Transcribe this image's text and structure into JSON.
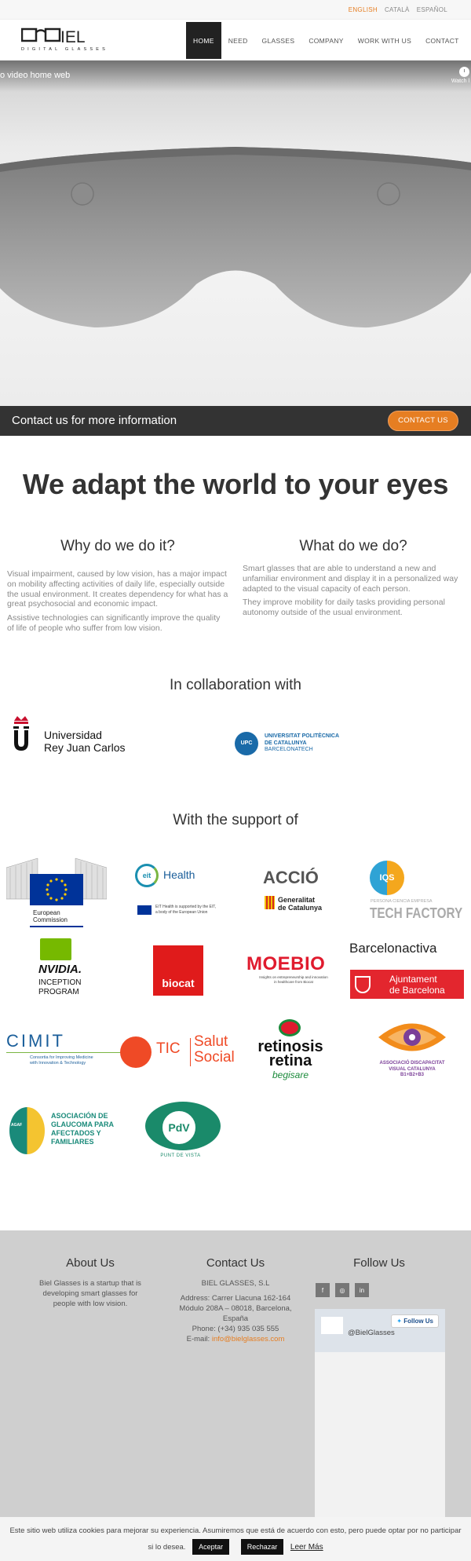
{
  "languages": {
    "english": "ENGLISH",
    "catala": "CATALÀ",
    "espanol": "ESPAÑOL"
  },
  "logo": {
    "brand_text": "IEL",
    "tagline": "DIGITAL GLASSES"
  },
  "nav": [
    "HOME",
    "NEED",
    "GLASSES",
    "COMPANY",
    "WORK WITH US",
    "CONTACT"
  ],
  "hero": {
    "video_title": "o video home web",
    "watch_later": "Watch l"
  },
  "cta": {
    "text": "Contact us for more information",
    "button": "CONTACT US"
  },
  "headline": "We adapt the world to your eyes",
  "why": {
    "title": "Why do we do it?",
    "p1": "Visual impairment, caused by low vision, has a major impact on mobility affecting activities of daily life, especially outside the usual environment. It creates dependency for what has a great psychosocial and economic impact.",
    "p2": "Assistive technologies can significantly improve the quality of life of people who suffer from low vision."
  },
  "what": {
    "title": "What do we do?",
    "p1": "Smart glasses that are able to understand a new and unfamiliar environment and display it in a personalized way adapted to the visual capacity of each person.",
    "p2": "They improve mobility for daily tasks providing personal autonomy outside of the usual environment."
  },
  "collaboration": {
    "title": "In collaboration with",
    "urjc": {
      "line1": "Universidad",
      "line2": "Rey Juan Carlos"
    },
    "upc": {
      "line1": "UNIVERSITAT POLITÈCNICA",
      "line2": "DE CATALUNYA",
      "line3": "BARCELONATECH",
      "badge": "UPC"
    }
  },
  "support": {
    "title": "With the support of",
    "ec": {
      "line1": "European",
      "line2": "Commission"
    },
    "eit": {
      "name": "Health",
      "badge": "eit",
      "note1": "EIT Health is supported by the EIT,",
      "note2": "a body of the European Union"
    },
    "accio": {
      "name": "ACCIÓ",
      "line1": "Generalitat",
      "line2": "de Catalunya"
    },
    "iqs": {
      "badge": "IQS",
      "sub": "PERSONA CIENCIA EMPRESA",
      "name": "TECH FACTORY"
    },
    "nvidia": {
      "name": "NVIDIA.",
      "line1": "INCEPTION",
      "line2": "PROGRAM"
    },
    "biocat": {
      "name": "biocat"
    },
    "moebio": {
      "name": "MOEBIO",
      "line1": "Insights on entrepreneurship and innovation",
      "line2": "in healthcare from Biocat"
    },
    "barcelona_activa": {
      "name": "Barcelonactiva",
      "line1": "Ajuntament",
      "line2": "de Barcelona"
    },
    "cimit": {
      "name": "CIMIT",
      "line1": "Consortia for Improving Medicine",
      "line2": "with Innovation & Technology"
    },
    "tic": {
      "name1": "TIC",
      "name2": "Salut",
      "name3": "Social"
    },
    "retinosis": {
      "line1": "retinosis",
      "line2": "retina",
      "line3": "begisare"
    },
    "associacio": {
      "line1": "ASSOCIACIÓ DISCAPACITAT",
      "line2": "VISUAL CATALUNYA",
      "line3": "B1+B2+B3"
    },
    "agaf": {
      "line1": "ASOCIACIÓN DE",
      "line2": "GLAUCOMA PARA",
      "line3": "AFECTADOS Y",
      "line4": "FAMILIARES",
      "badge": "AGAF"
    },
    "pdv": {
      "badge": "PdV",
      "name": "PUNT DE VISTA"
    }
  },
  "footer": {
    "about": {
      "title": "About Us",
      "text": "Biel Glasses is a startup that is developing smart glasses for people with low vision."
    },
    "contact": {
      "title": "Contact Us",
      "company": "BIEL GLASSES, S.L",
      "address": "Address: Carrer Llacuna 162-164 Módulo 208A – 08018, Barcelona, España",
      "phone": "Phone: (+34) 935 035 555",
      "email_label": "E-mail:",
      "email": "info@bielglasses.com"
    },
    "follow": {
      "title": "Follow Us",
      "twitter_handle": "@BielGlasses",
      "follow_button": "Follow Us"
    }
  },
  "cookie": {
    "text": "Este sitio web utiliza cookies para mejorar su experiencia. Asumiremos que está de acuerdo con esto, pero puede optar por no participar si lo desea.",
    "accept": "Aceptar",
    "reject": "Rechazar",
    "more": "Leer Más"
  },
  "colors": {
    "accent": "#e67e22",
    "dark": "#333333",
    "footer_bg": "#cfcfcf"
  }
}
